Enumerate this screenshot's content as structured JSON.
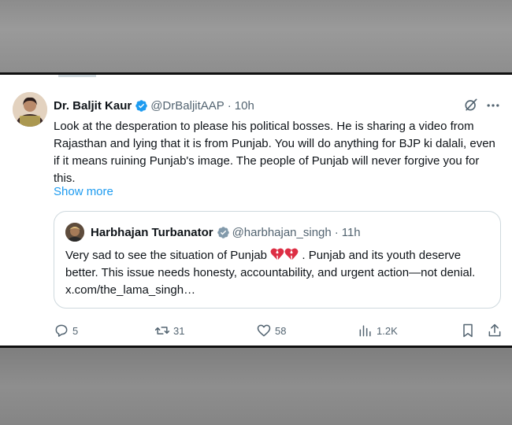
{
  "author": {
    "name": "Dr. Baljit Kaur",
    "handle": "@DrBaljitAAP",
    "time": "10h"
  },
  "tweet": {
    "text": "Look at the desperation to please his political bosses. He is sharing a video from Rajasthan and lying that it is from Punjab. You will do anything for BJP ki dalali, even if it means ruining Punjab's image. The people of Punjab will never forgive you for this.",
    "show_more": "Show more"
  },
  "quoted": {
    "name": "Harbhajan Turbanator",
    "handle": "@harbhajan_singh",
    "time": "11h",
    "text_before_emoji": "Very sad to see the situation of Punjab",
    "text_after_emoji": " . Punjab and its youth deserve better. This issue needs honesty, accountability, and urgent action—not denial. x.com/the_lama_singh…"
  },
  "actions": {
    "replies": "5",
    "reposts": "31",
    "likes": "58",
    "views": "1.2K"
  },
  "colors": {
    "accent": "#1d9bf0",
    "text": "#0f1419",
    "muted": "#536471",
    "border": "#cfd9de"
  }
}
